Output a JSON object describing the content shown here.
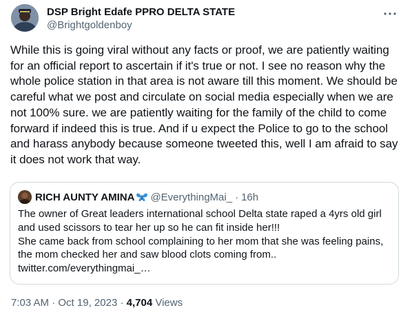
{
  "author": {
    "display_name": "DSP Bright Edafe PPRO DELTA STATE",
    "handle": "@Brightgoldenboy"
  },
  "tweet": {
    "text": "While this is going viral without any facts or proof, we are patiently waiting for an official report to ascertain if it's true or not. I see no reason why the whole police station in that area is not aware till this moment. We should be careful what we post and circulate on social media especially when we are not 100% sure. we are patiently waiting for the family of the child to come forward if indeed this is true. And if u expect the Police to go to the school and harass anybody because someone tweeted this, well I am afraid to say it does not work that way.",
    "time": "7:03 AM",
    "date": "Oct 19, 2023",
    "separator": "·",
    "views_count": "4,704",
    "views_label": "Views"
  },
  "quoted_tweet": {
    "display_name": "RICH AUNTY AMINA",
    "handle": "@EverythingMai_",
    "separator": "·",
    "time": "16h",
    "text": "The owner of Great leaders international school Delta state raped a 4yrs old girl and used scissors to tear her up so he can fit inside her!!!\n  She came back from school complaining to her mom that she was feeling pains, the mom checked her and saw blood clots coming from.. twitter.com/everythingmai_…"
  },
  "icons": {
    "more": "more-horizontal-icon",
    "badge": "butterfly-emoji"
  },
  "colors": {
    "text_primary": "#0f1419",
    "text_secondary": "#536471",
    "border": "#cfd9de",
    "butterfly": "#1d9bf0"
  }
}
